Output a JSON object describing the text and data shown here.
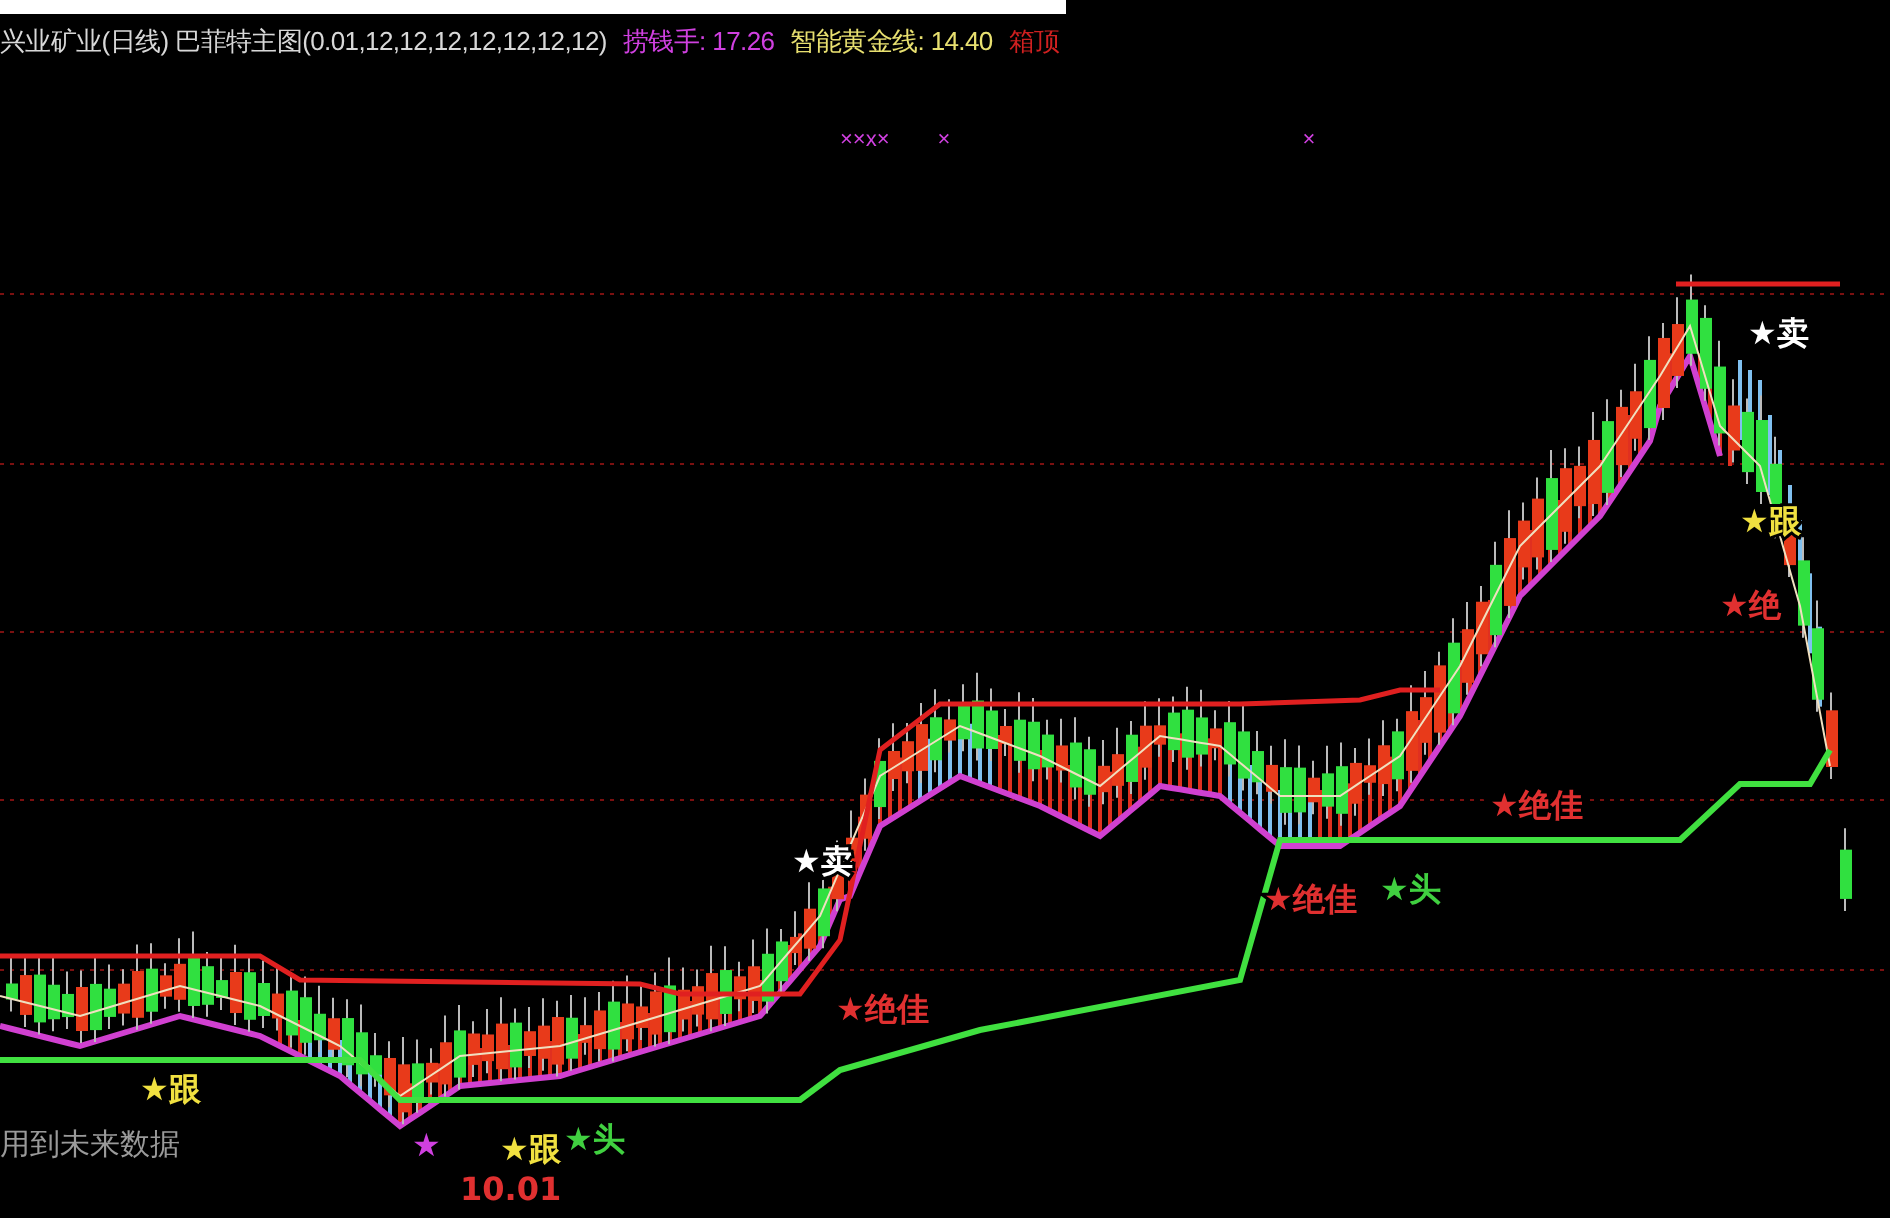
{
  "header": {
    "title": "兴业矿业(日线) 巴菲特主图(0.01,12,12,12,12,12,12,12)",
    "indicators": [
      {
        "label": "捞钱手: 17.26",
        "color": "#d040e0"
      },
      {
        "label": "智能黄金线: 14.40",
        "color": "#e8e070"
      },
      {
        "label": "箱顶",
        "color": "#d02020"
      }
    ]
  },
  "markers": [
    "××x×",
    "×",
    "×"
  ],
  "signals": [
    {
      "text": "★跟",
      "color": "#f0e040"
    },
    {
      "text": "★",
      "color": "#d040e0"
    },
    {
      "text": "10.01",
      "color": "#e03030"
    },
    {
      "text": "★跟",
      "color": "#f0e040"
    },
    {
      "text": "★头",
      "color": "#40d040"
    },
    {
      "text": "★绝佳",
      "color": "#e03030"
    },
    {
      "text": "★卖",
      "color": "#ffffff"
    },
    {
      "text": "★绝佳",
      "color": "#e03030"
    },
    {
      "text": "★头",
      "color": "#40d040"
    },
    {
      "text": "★绝佳",
      "color": "#e03030"
    },
    {
      "text": "★卖",
      "color": "#ffffff"
    },
    {
      "text": "★跟",
      "color": "#f0e040"
    },
    {
      "text": "★绝",
      "color": "#e03030"
    }
  ],
  "footnote": "用到未来数据"
}
